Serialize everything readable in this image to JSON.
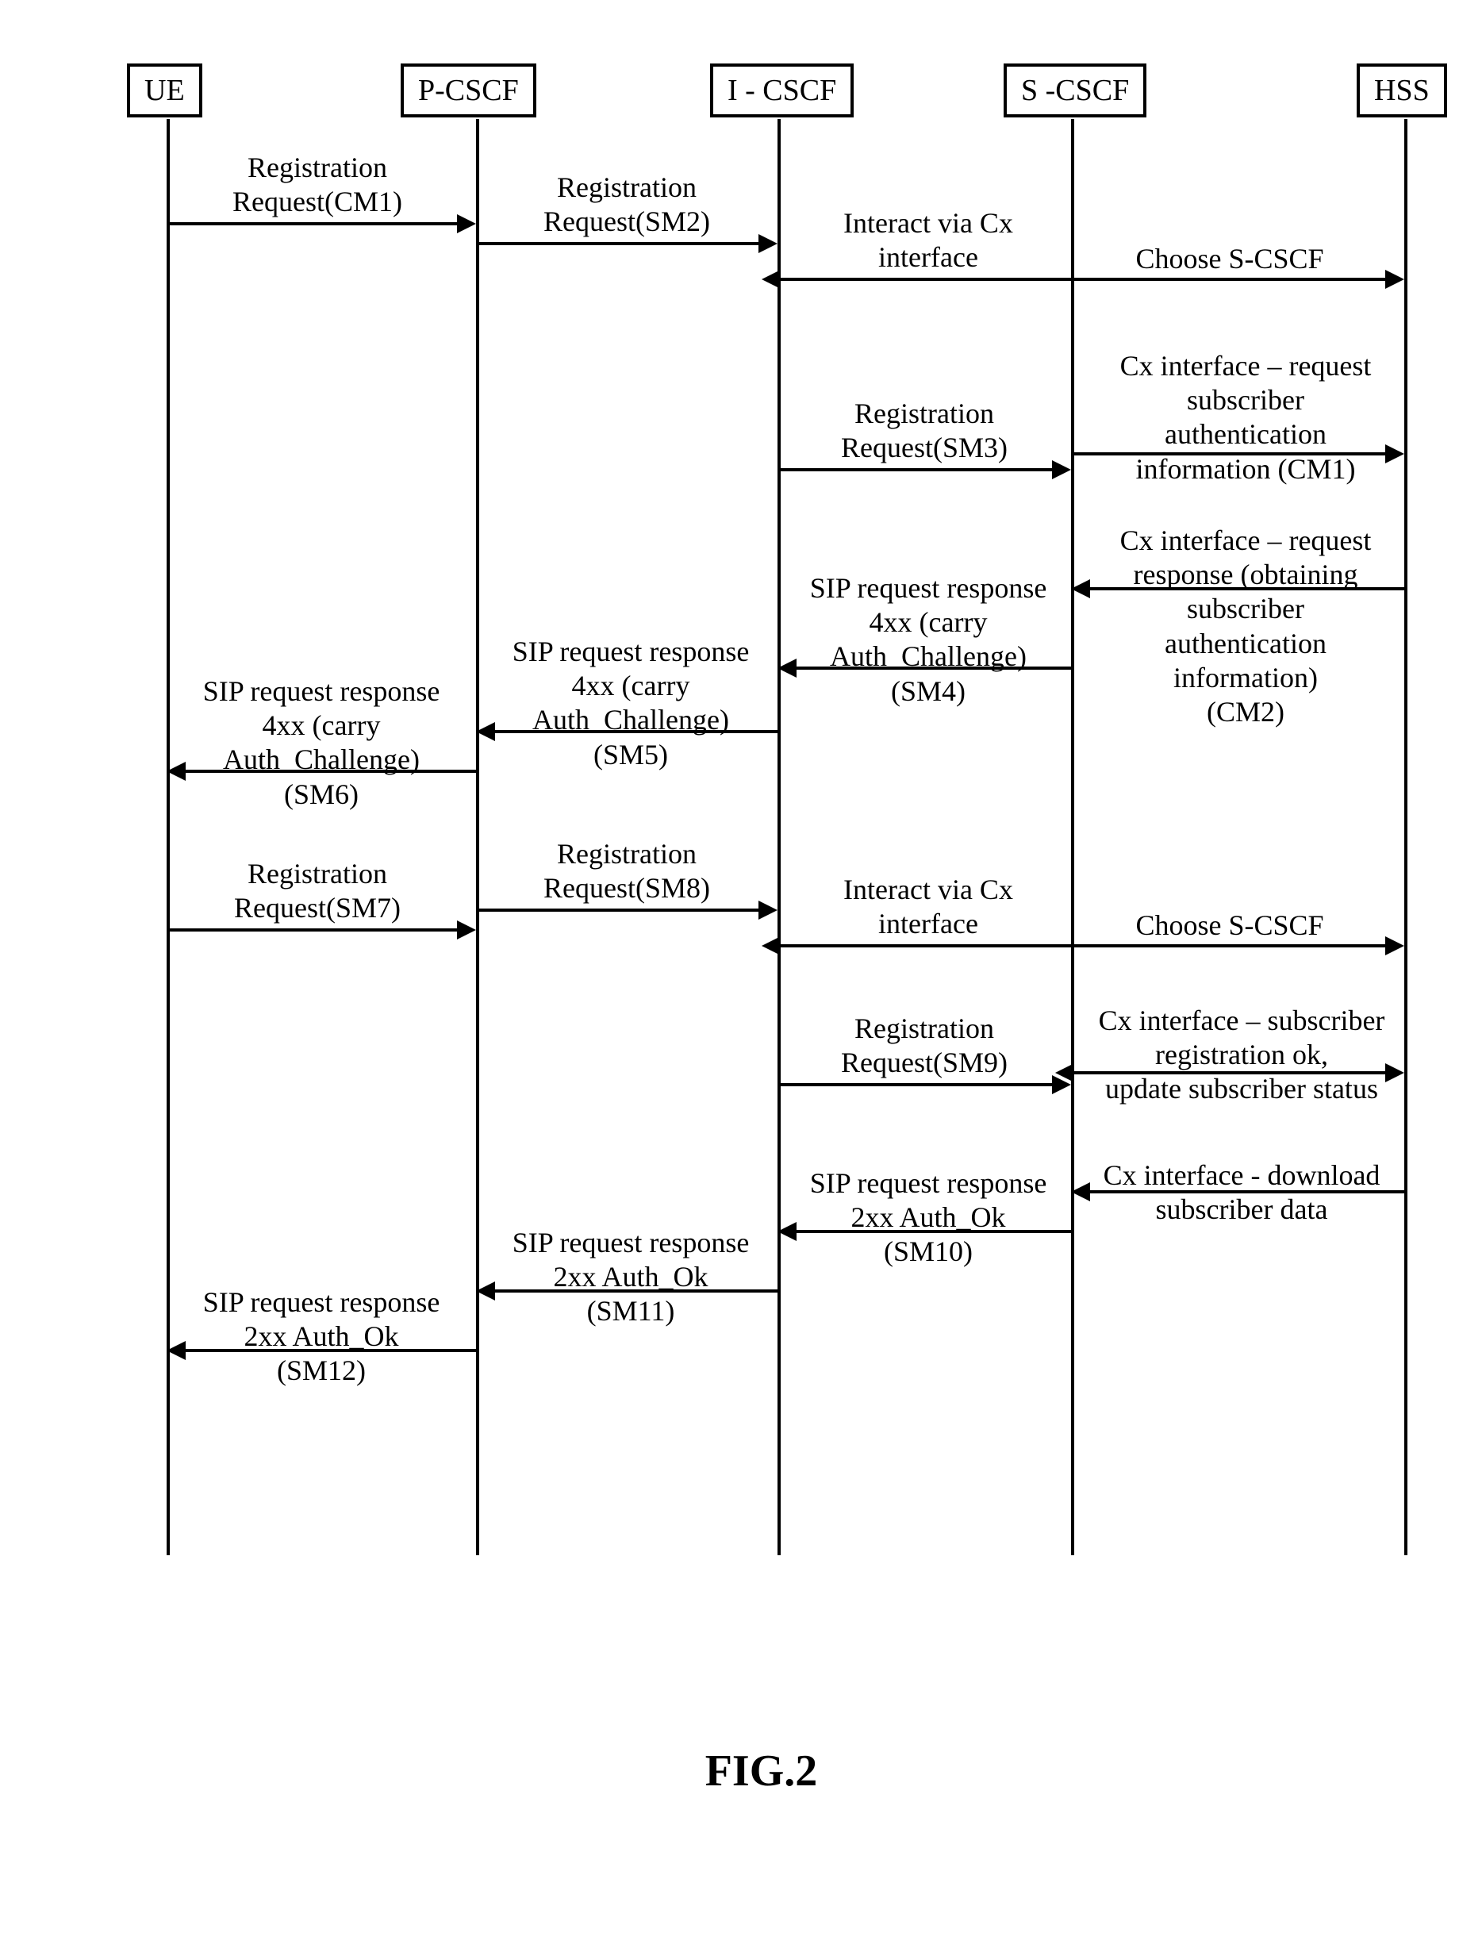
{
  "entities": {
    "ue": "UE",
    "pcscf": "P-CSCF",
    "icscf": "I - CSCF",
    "scscf": "S -CSCF",
    "hss": "HSS"
  },
  "messages": {
    "m1": "Registration\nRequest(CM1)",
    "m2": "Registration\nRequest(SM2)",
    "m3": "Interact via Cx\ninterface",
    "m4": "Choose S-CSCF",
    "m5": "Registration\nRequest(SM3)",
    "m6": "Cx interface – request\nsubscriber\nauthentication\ninformation (CM1)",
    "m7": "Cx interface – request\nresponse (obtaining\nsubscriber\nauthentication\ninformation)\n(CM2)",
    "m8": "SIP request response\n4xx (carry\nAuth_Challenge)\n(SM4)",
    "m9": "SIP request response\n4xx (carry\nAuth_Challenge)\n(SM5)",
    "m10": "SIP request response\n4xx (carry\nAuth_Challenge)\n(SM6)",
    "m11": "Registration\nRequest(SM7)",
    "m12": "Registration\nRequest(SM8)",
    "m13": "Interact via Cx\ninterface",
    "m14": "Choose S-CSCF",
    "m15": "Registration\nRequest(SM9)",
    "m16": "Cx interface – subscriber\nregistration ok,\nupdate subscriber status",
    "m17": "Cx interface - download\nsubscriber data",
    "m18": "SIP request response\n2xx Auth_Ok\n(SM10)",
    "m19": "SIP request response\n2xx Auth_Ok\n(SM11)",
    "m20": "SIP request response\n2xx Auth_Ok\n(SM12)"
  },
  "caption": "FIG.2"
}
